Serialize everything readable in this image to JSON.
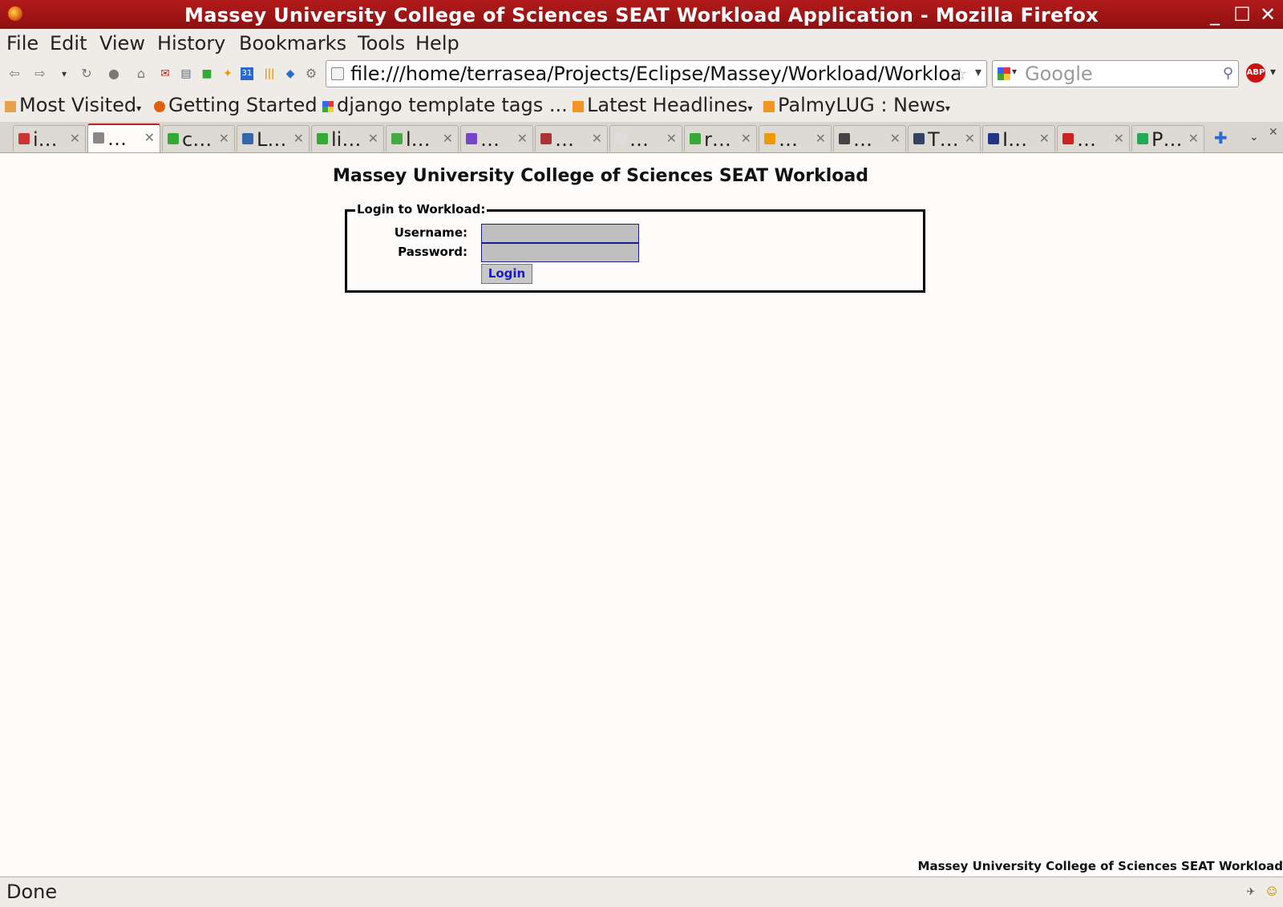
{
  "window": {
    "title": "Massey University College of Sciences SEAT Workload Application - Mozilla Firefox"
  },
  "menu": [
    "File",
    "Edit",
    "View",
    "History",
    "Bookmarks",
    "Tools",
    "Help"
  ],
  "nav": {
    "url": "file:///home/terrasea/Projects/Eclipse/Massey/Workload/Workload",
    "search_placeholder": "Google",
    "abp": "ABP"
  },
  "bookmarks": [
    "Most Visited",
    "Getting Started",
    "django template tags ...",
    "Latest Headlines",
    "PalmyLUG : News"
  ],
  "tabs": [
    {
      "label": "i…",
      "color": "#c33"
    },
    {
      "label": "…",
      "color": "#888"
    },
    {
      "label": "c…",
      "color": "#3a3"
    },
    {
      "label": "L…",
      "color": "#36a"
    },
    {
      "label": "li…",
      "color": "#3a3"
    },
    {
      "label": "l…",
      "color": "#4a4"
    },
    {
      "label": "…",
      "color": "#74c"
    },
    {
      "label": "…",
      "color": "#a33"
    },
    {
      "label": "…",
      "color": "#ddd"
    },
    {
      "label": "r…",
      "color": "#3a3"
    },
    {
      "label": "…",
      "color": "#e90"
    },
    {
      "label": "…",
      "color": "#444"
    },
    {
      "label": "T…",
      "color": "#346"
    },
    {
      "label": "I…",
      "color": "#238"
    },
    {
      "label": "…",
      "color": "#c22"
    },
    {
      "label": "P…",
      "color": "#2a5"
    }
  ],
  "page": {
    "heading": "Massey University College of Sciences SEAT Workload",
    "legend": "Login to Workload:",
    "username_label": "Username:",
    "password_label": "Password:",
    "login_button": "Login",
    "footer": "Massey University College of Sciences SEAT Workload"
  },
  "status": {
    "text": "Done"
  }
}
